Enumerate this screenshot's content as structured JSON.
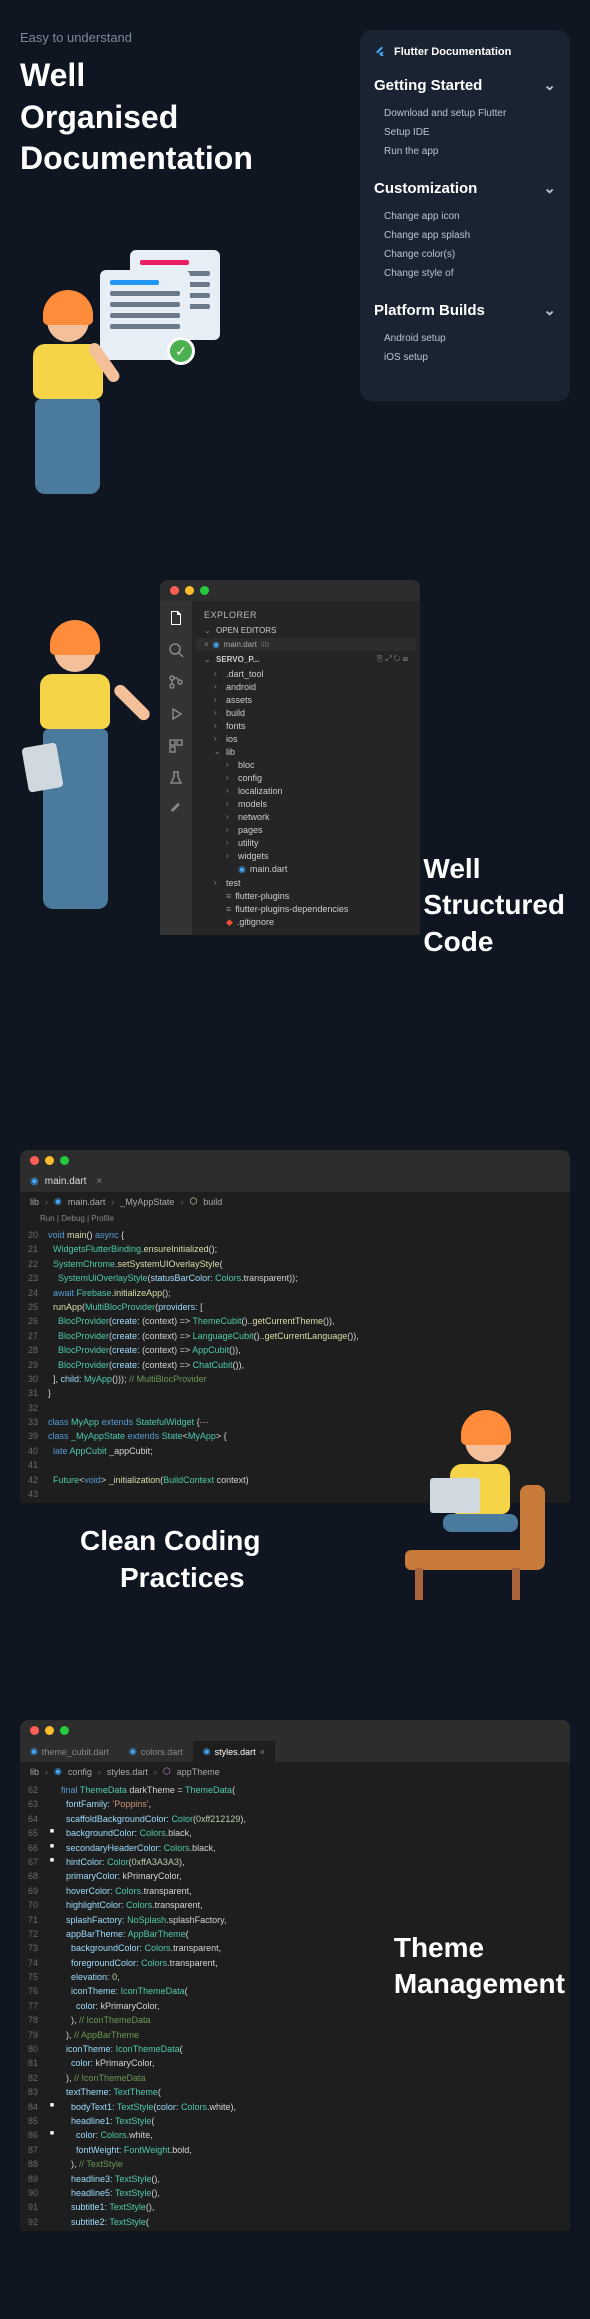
{
  "s1": {
    "eyebrow": "Easy to understand",
    "title_l1": "Well",
    "title_l2": "Organised",
    "title_l3": "Documentation",
    "doc": {
      "header": "Flutter Documentation",
      "groups": [
        {
          "title": "Getting Started",
          "items": [
            "Download and setup Flutter",
            "Setup IDE",
            "Run the app"
          ]
        },
        {
          "title": "Customization",
          "items": [
            "Change app icon",
            "Change app splash",
            "Change color(s)",
            "Change style of"
          ]
        },
        {
          "title": "Platform Builds",
          "items": [
            "Android setup",
            "iOS setup"
          ]
        }
      ]
    }
  },
  "s2": {
    "title_l1": "Well",
    "title_l2": "Structured",
    "title_l3": "Code",
    "explorer": {
      "title": "EXPLORER",
      "open_editors": "OPEN EDITORS",
      "open_tab": "main.dart",
      "open_tab_path": "lib",
      "proj": "SERVO_P...",
      "tree": [
        {
          "n": ".dart_tool",
          "t": "folder",
          "l": 0,
          "open": false
        },
        {
          "n": "android",
          "t": "folder",
          "l": 0,
          "open": false
        },
        {
          "n": "assets",
          "t": "folder",
          "l": 0,
          "open": false
        },
        {
          "n": "build",
          "t": "folder",
          "l": 0,
          "open": false
        },
        {
          "n": "fonts",
          "t": "folder",
          "l": 0,
          "open": false
        },
        {
          "n": "ios",
          "t": "folder",
          "l": 0,
          "open": false
        },
        {
          "n": "lib",
          "t": "folder",
          "l": 0,
          "open": true
        },
        {
          "n": "bloc",
          "t": "folder",
          "l": 1,
          "open": false
        },
        {
          "n": "config",
          "t": "folder",
          "l": 1,
          "open": false
        },
        {
          "n": "localization",
          "t": "folder",
          "l": 1,
          "open": false
        },
        {
          "n": "models",
          "t": "folder",
          "l": 1,
          "open": false
        },
        {
          "n": "network",
          "t": "folder",
          "l": 1,
          "open": false
        },
        {
          "n": "pages",
          "t": "folder",
          "l": 1,
          "open": false
        },
        {
          "n": "utility",
          "t": "folder",
          "l": 1,
          "open": false
        },
        {
          "n": "widgets",
          "t": "folder",
          "l": 1,
          "open": false
        },
        {
          "n": "main.dart",
          "t": "file",
          "l": 1,
          "icon": "dart"
        },
        {
          "n": "test",
          "t": "folder",
          "l": 0,
          "open": false
        },
        {
          "n": "flutter-plugins",
          "t": "file",
          "l": 0,
          "icon": "file"
        },
        {
          "n": "flutter-plugins-dependencies",
          "t": "file",
          "l": 0,
          "icon": "file"
        },
        {
          "n": ".gitignore",
          "t": "file",
          "l": 0,
          "icon": "git"
        }
      ]
    }
  },
  "s3": {
    "title_l1": "Clean Coding",
    "title_l2": "Practices",
    "tab": "main.dart",
    "breadcrumb": [
      "lib",
      "main.dart",
      "_MyAppState",
      "build"
    ],
    "toolbar": "Run | Debug | Profile",
    "lines": [
      {
        "n": 20,
        "html": "<span class='kw'>void</span> <span class='fn'>main</span>() <span class='kw'>async</span> {"
      },
      {
        "n": 21,
        "html": "  <span class='cls'>WidgetsFlutterBinding</span>.<span class='fn'>ensureInitialized</span>();"
      },
      {
        "n": 22,
        "html": "  <span class='cls'>SystemChrome</span>.<span class='fn'>setSystemUIOverlayStyle</span>("
      },
      {
        "n": 23,
        "html": "    <span class='cls'>SystemUiOverlayStyle</span>(<span class='prop'>statusBarColor:</span> <span class='cls'>Colors</span>.transparent));"
      },
      {
        "n": 24,
        "html": "  <span class='kw'>await</span> <span class='cls'>Firebase</span>.<span class='fn'>initializeApp</span>();"
      },
      {
        "n": 25,
        "html": "  <span class='fn'>runApp</span>(<span class='cls'>MultiBlocProvider</span>(<span class='prop'>providers:</span> ["
      },
      {
        "n": 26,
        "html": "    <span class='cls'>BlocProvider</span>(<span class='prop'>create:</span> (context) => <span class='cls'>ThemeCubit</span>()..<span class='fn'>getCurrentTheme</span>()),"
      },
      {
        "n": 27,
        "html": "    <span class='cls'>BlocProvider</span>(<span class='prop'>create:</span> (context) => <span class='cls'>LanguageCubit</span>()..<span class='fn'>getCurrentLanguage</span>()),"
      },
      {
        "n": 28,
        "html": "    <span class='cls'>BlocProvider</span>(<span class='prop'>create:</span> (context) => <span class='cls'>AppCubit</span>()),"
      },
      {
        "n": 29,
        "html": "    <span class='cls'>BlocProvider</span>(<span class='prop'>create:</span> (context) => <span class='cls'>ChatCubit</span>()),"
      },
      {
        "n": 30,
        "html": "  ], <span class='prop'>child:</span> <span class='cls'>MyApp</span>())); <span class='cmt'>// MultiBlocProvider</span>"
      },
      {
        "n": 31,
        "html": "}"
      },
      {
        "n": 32,
        "html": ""
      },
      {
        "n": 33,
        "html": "<span class='kw'>class</span> <span class='cls'>MyApp</span> <span class='kw'>extends</span> <span class='cls'>StatefulWidget</span> {···"
      },
      {
        "n": "",
        "html": ""
      },
      {
        "n": 39,
        "html": "<span class='kw'>class</span> <span class='cls'>_MyAppState</span> <span class='kw'>extends</span> <span class='cls'>State</span>&lt;<span class='cls'>MyApp</span>&gt; {"
      },
      {
        "n": 40,
        "html": "  <span class='kw'>late</span> <span class='cls'>AppCubit</span> _appCubit;"
      },
      {
        "n": 41,
        "html": ""
      },
      {
        "n": 42,
        "html": "  <span class='cls'>Future</span>&lt;<span class='kw'>void</span>&gt; <span class='fn'>_initialization</span>(<span class='cls'>BuildContext</span> context)"
      },
      {
        "n": 43,
        "html": ""
      }
    ]
  },
  "s4": {
    "title_l1": "Theme",
    "title_l2": "Management",
    "tabs": [
      {
        "label": "theme_cubit.dart",
        "active": false
      },
      {
        "label": "colors.dart",
        "active": false
      },
      {
        "label": "styles.dart",
        "active": true
      }
    ],
    "breadcrumb": [
      "lib",
      "config",
      "styles.dart",
      "appTheme"
    ],
    "lines": [
      {
        "n": 62,
        "m": "",
        "html": "  <span class='kw'>final</span> <span class='cls'>ThemeData</span> darkTheme = <span class='cls'>ThemeData</span>("
      },
      {
        "n": 63,
        "m": "",
        "html": "    <span class='prop'>fontFamily:</span> <span class='str'>'Poppins'</span>,"
      },
      {
        "n": 64,
        "m": "",
        "html": "    <span class='prop'>scaffoldBackgroundColor:</span> <span class='cls'>Color</span>(<span class='num'>0xff212129</span>),"
      },
      {
        "n": 65,
        "m": "■",
        "html": "    <span class='prop'>backgroundColor:</span> <span class='cls'>Colors</span>.black,"
      },
      {
        "n": 66,
        "m": "■",
        "html": "    <span class='prop'>secondaryHeaderColor:</span> <span class='cls'>Colors</span>.black,"
      },
      {
        "n": 67,
        "m": "■",
        "html": "    <span class='prop'>hintColor:</span> <span class='cls'>Color</span>(<span class='num'>0xffA3A3A3</span>),"
      },
      {
        "n": 68,
        "m": "",
        "html": "    <span class='prop'>primaryColor:</span> kPrimaryColor,"
      },
      {
        "n": 69,
        "m": "",
        "html": "    <span class='prop'>hoverColor:</span> <span class='cls'>Colors</span>.transparent,"
      },
      {
        "n": 70,
        "m": "",
        "html": "    <span class='prop'>highlightColor:</span> <span class='cls'>Colors</span>.transparent,"
      },
      {
        "n": 71,
        "m": "",
        "html": "    <span class='prop'>splashFactory:</span> <span class='cls'>NoSplash</span>.splashFactory,"
      },
      {
        "n": 72,
        "m": "",
        "html": "    <span class='prop'>appBarTheme:</span> <span class='cls'>AppBarTheme</span>("
      },
      {
        "n": 73,
        "m": "",
        "html": "      <span class='prop'>backgroundColor:</span> <span class='cls'>Colors</span>.transparent,"
      },
      {
        "n": 74,
        "m": "",
        "html": "      <span class='prop'>foregroundColor:</span> <span class='cls'>Colors</span>.transparent,"
      },
      {
        "n": 75,
        "m": "",
        "html": "      <span class='prop'>elevation:</span> <span class='num'>0</span>,"
      },
      {
        "n": 76,
        "m": "",
        "html": "      <span class='prop'>iconTheme:</span> <span class='cls'>IconThemeData</span>("
      },
      {
        "n": 77,
        "m": "",
        "html": "        <span class='prop'>color:</span> kPrimaryColor,"
      },
      {
        "n": 78,
        "m": "",
        "html": "      ), <span class='cmt'>// IconThemeData</span>"
      },
      {
        "n": 79,
        "m": "",
        "html": "    ), <span class='cmt'>// AppBarTheme</span>"
      },
      {
        "n": 80,
        "m": "",
        "html": "    <span class='prop'>iconTheme:</span> <span class='cls'>IconThemeData</span>("
      },
      {
        "n": 81,
        "m": "",
        "html": "      <span class='prop'>color:</span> kPrimaryColor,"
      },
      {
        "n": 82,
        "m": "",
        "html": "    ), <span class='cmt'>// IconThemeData</span>"
      },
      {
        "n": 83,
        "m": "",
        "html": "    <span class='prop'>textTheme:</span> <span class='cls'>TextTheme</span>("
      },
      {
        "n": 84,
        "m": "■",
        "html": "      <span class='prop'>bodyText1:</span> <span class='cls'>TextStyle</span>(<span class='prop'>color:</span> <span class='cls'>Colors</span>.white),"
      },
      {
        "n": 85,
        "m": "",
        "html": "      <span class='prop'>headline1:</span> <span class='cls'>TextStyle</span>("
      },
      {
        "n": 86,
        "m": "■",
        "html": "        <span class='prop'>color:</span> <span class='cls'>Colors</span>.white,"
      },
      {
        "n": 87,
        "m": "",
        "html": "        <span class='prop'>fontWeight:</span> <span class='cls'>FontWeight</span>.bold,"
      },
      {
        "n": 88,
        "m": "",
        "html": "      ), <span class='cmt'>// TextStyle</span>"
      },
      {
        "n": 89,
        "m": "",
        "html": "      <span class='prop'>headline3:</span> <span class='cls'>TextStyle</span>(),"
      },
      {
        "n": 90,
        "m": "",
        "html": "      <span class='prop'>headline5:</span> <span class='cls'>TextStyle</span>(),"
      },
      {
        "n": 91,
        "m": "",
        "html": "      <span class='prop'>subtitle1:</span> <span class='cls'>TextStyle</span>(),"
      },
      {
        "n": 92,
        "m": "",
        "html": "      <span class='prop'>subtitle2:</span> <span class='cls'>TextStyle</span>("
      }
    ]
  }
}
